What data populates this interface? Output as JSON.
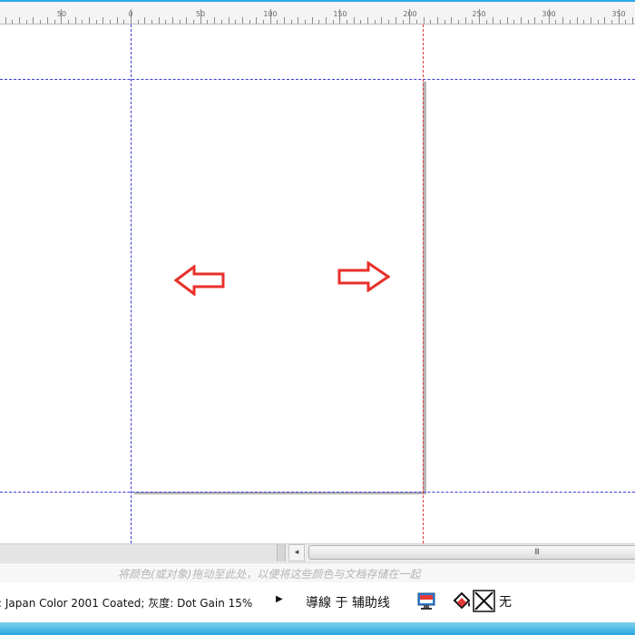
{
  "ruler": {
    "labels": [
      "50",
      "0",
      "50",
      "100",
      "150",
      "200",
      "250",
      "300",
      "350"
    ]
  },
  "canvas": {
    "left_arrow": "arrow-left-icon",
    "right_arrow": "arrow-right-icon",
    "arrow_color": "#e8302a"
  },
  "scrollbar": {
    "left_button_glyph": "◂",
    "thumb_grip": "III"
  },
  "palette_hint": "将颜色(或对象)拖动至此处，以便将这些颜色与文档存储在一起",
  "status": {
    "color_profile": ": Japan Color 2001 Coated; 灰度: Dot Gain 15%",
    "play_glyph": "▶",
    "snap_text": "導線 于 辅助线",
    "fill_icon": "fill-bucket-icon",
    "outline_icon": "no-outline-icon",
    "none_text": "无"
  },
  "colors": {
    "guide_blue": "#3a3ad6",
    "guide_red": "#e03a3a",
    "accent": "#2aa6e0"
  }
}
